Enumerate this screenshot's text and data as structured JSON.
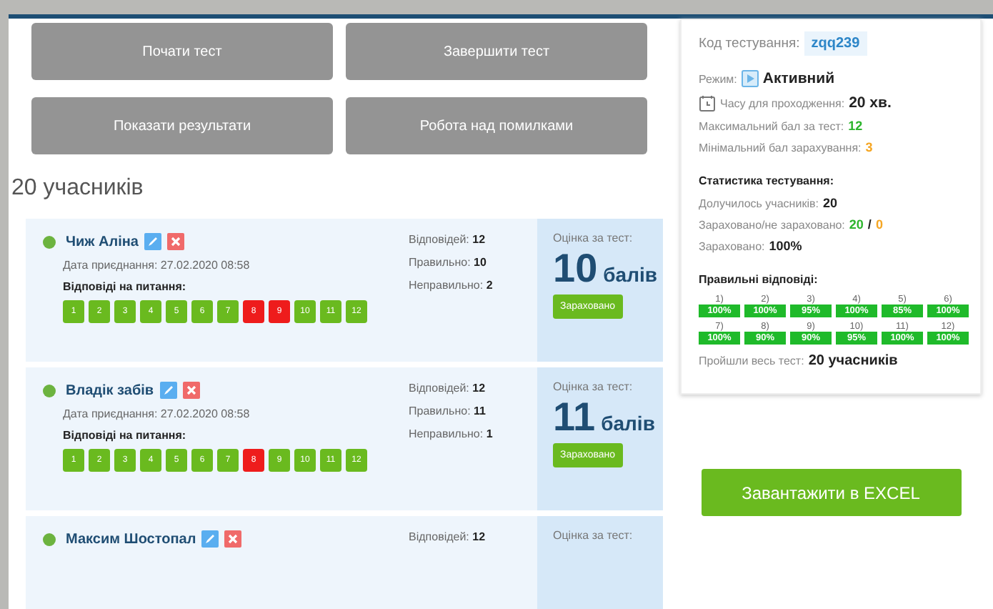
{
  "actions": [
    {
      "label": "Почати тест",
      "disabled": true
    },
    {
      "label": "Завершити тест",
      "disabled": true
    },
    {
      "label": "Показати результати",
      "disabled": true
    },
    {
      "label": "Робота над помилками",
      "disabled": true
    }
  ],
  "participants_title": "20 учасників",
  "participants": [
    {
      "name": "Чиж Аліна",
      "online": true,
      "date": "Дата приєднання: 27.02.2020 08:58",
      "answers_label": "Відповіді на питання:",
      "answers": [
        {
          "n": "1",
          "correct": true
        },
        {
          "n": "2",
          "correct": true
        },
        {
          "n": "3",
          "correct": true
        },
        {
          "n": "4",
          "correct": true
        },
        {
          "n": "5",
          "correct": true
        },
        {
          "n": "6",
          "correct": true
        },
        {
          "n": "7",
          "correct": true
        },
        {
          "n": "8",
          "correct": false
        },
        {
          "n": "9",
          "correct": false
        },
        {
          "n": "10",
          "correct": true
        },
        {
          "n": "11",
          "correct": true
        },
        {
          "n": "12",
          "correct": true
        }
      ],
      "stats": [
        "Відповідей: **12**",
        "Правильно: **10**",
        "Неправильно: **2**"
      ],
      "score_label": "Оцінка за тест:",
      "score": "10",
      "score_unit": "балів",
      "status": "Зараховано"
    },
    {
      "name": "Владік забів",
      "online": true,
      "date": "Дата приєднання: 27.02.2020 08:58",
      "answers_label": "Відповіді на питання:",
      "answers": [
        {
          "n": "1",
          "correct": true
        },
        {
          "n": "2",
          "correct": true
        },
        {
          "n": "3",
          "correct": true
        },
        {
          "n": "4",
          "correct": true
        },
        {
          "n": "5",
          "correct": true
        },
        {
          "n": "6",
          "correct": true
        },
        {
          "n": "7",
          "correct": true
        },
        {
          "n": "8",
          "correct": false
        },
        {
          "n": "9",
          "correct": true
        },
        {
          "n": "10",
          "correct": true
        },
        {
          "n": "11",
          "correct": true
        },
        {
          "n": "12",
          "correct": true
        }
      ],
      "stats": [
        "Відповідей: **12**",
        "Правильно: **11**",
        "Неправильно: **1**"
      ],
      "score_label": "Оцінка за тест:",
      "score": "11",
      "score_unit": "балів",
      "status": "Зараховано"
    },
    {
      "name": "Максим Шостопал",
      "online": true,
      "stats": [
        "Відповідей: **12**"
      ],
      "score_label": "Оцінка за тест:"
    }
  ],
  "info": {
    "code_label": "Код тестування:",
    "code": "zqq239",
    "mode_label": "Режим:",
    "mode": "Активний",
    "time_label": "Часу для проходження:",
    "time": "20 хв.",
    "lines": [
      {
        "label": "Максимальний бал за тест:",
        "parts": [
          {
            "text": "12",
            "kind": "green"
          }
        ]
      },
      {
        "label": "Мінімальний бал зарахування:",
        "parts": [
          {
            "text": "3",
            "kind": "orange"
          }
        ]
      }
    ]
  },
  "statistics": {
    "title": "Статистика тестування:",
    "lines": [
      {
        "label": "Долучилось учасників:",
        "parts": [
          {
            "text": "20",
            "kind": "bold"
          }
        ]
      },
      {
        "label": "Зараховано/не зараховано:",
        "parts": [
          {
            "text": "20",
            "kind": "green"
          },
          {
            "text": "/",
            "kind": "plain"
          },
          {
            "text": "0",
            "kind": "orange"
          }
        ]
      },
      {
        "label": "Зараховано:",
        "parts": [
          {
            "text": "100%",
            "kind": "bold"
          }
        ]
      }
    ],
    "correct_title": "Правильні відповіді:",
    "questions": [
      {
        "label": "1)",
        "value": "100%"
      },
      {
        "label": "2)",
        "value": "100%"
      },
      {
        "label": "3)",
        "value": "95%"
      },
      {
        "label": "4)",
        "value": "100%"
      },
      {
        "label": "5)",
        "value": "85%"
      },
      {
        "label": "6)",
        "value": "100%"
      },
      {
        "label": "7)",
        "value": "100%"
      },
      {
        "label": "8)",
        "value": "90%"
      },
      {
        "label": "9)",
        "value": "90%"
      },
      {
        "label": "10)",
        "value": "95%"
      },
      {
        "label": "11)",
        "value": "100%"
      },
      {
        "label": "12)",
        "value": "100%"
      }
    ],
    "passed": "Пройшли весь тест: **20 учасників**"
  },
  "export_button": "Завантажити в EXCEL"
}
